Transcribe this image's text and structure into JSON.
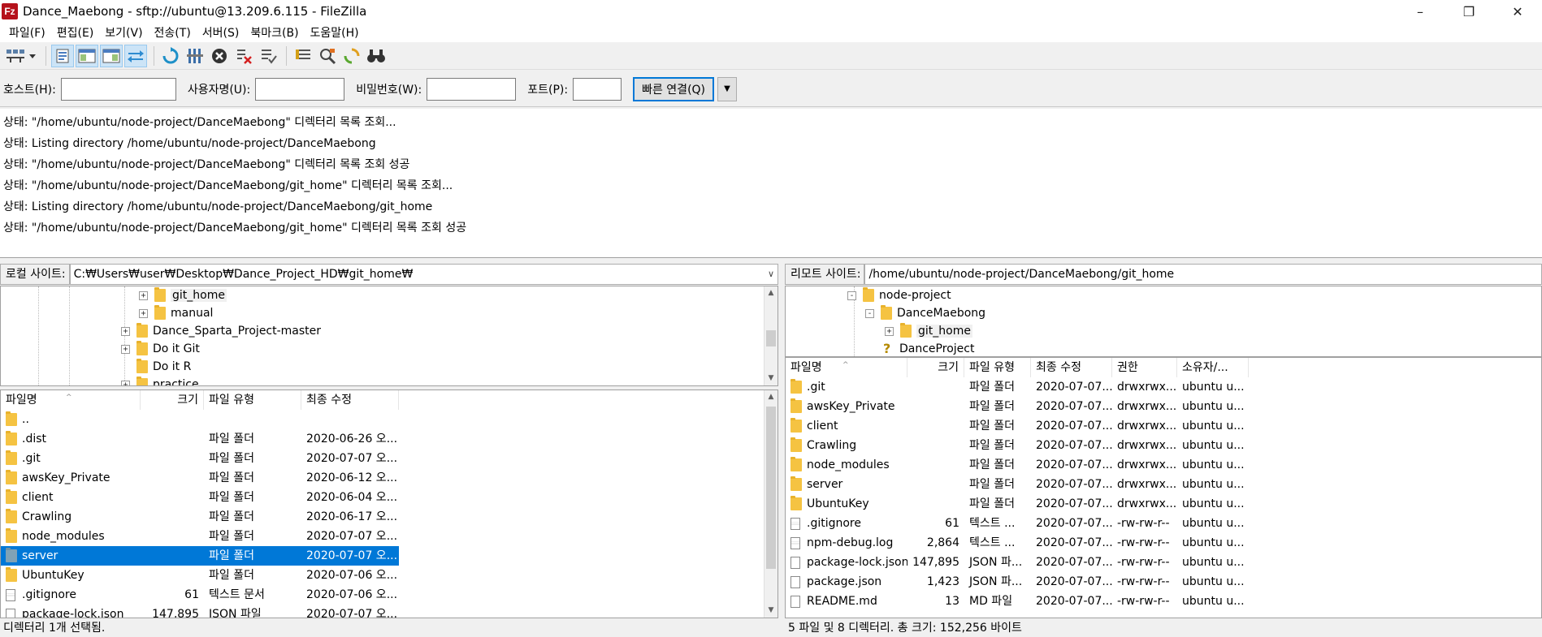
{
  "window": {
    "title": "Dance_Maebong - sftp://ubuntu@13.209.6.115 - FileZilla",
    "app_icon_text": "Fz"
  },
  "menu": [
    "파일(F)",
    "편집(E)",
    "보기(V)",
    "전송(T)",
    "서버(S)",
    "북마크(B)",
    "도움말(H)"
  ],
  "toolbar_icons": [
    "site-manager-icon",
    "toggle-log-icon",
    "toggle-local-tree-icon",
    "toggle-remote-tree-icon",
    "toggle-queue-icon",
    "refresh-icon",
    "process-queue-icon",
    "cancel-icon",
    "disconnect-icon",
    "reconnect-icon",
    "filter-icon",
    "compare-icon",
    "sync-browse-icon",
    "search-icon"
  ],
  "quickconnect": {
    "host_label": "호스트(H):",
    "user_label": "사용자명(U):",
    "pass_label": "비밀번호(W):",
    "port_label": "포트(P):",
    "host_value": "",
    "user_value": "",
    "pass_value": "",
    "port_value": "",
    "button": "빠른 연결(Q)"
  },
  "log": [
    "상태:  \"/home/ubuntu/node-project/DanceMaebong\" 디렉터리 목록 조회...",
    "상태:  Listing directory /home/ubuntu/node-project/DanceMaebong",
    "상태:  \"/home/ubuntu/node-project/DanceMaebong\" 디렉터리 목록 조회 성공",
    "상태:  \"/home/ubuntu/node-project/DanceMaebong/git_home\" 디렉터리 목록 조회...",
    "상태:  Listing directory /home/ubuntu/node-project/DanceMaebong/git_home",
    "상태:  \"/home/ubuntu/node-project/DanceMaebong/git_home\" 디렉터리 목록 조회 성공"
  ],
  "local": {
    "site_label": "로컬 사이트:",
    "path": "C:₩Users₩user₩Desktop₩Dance_Project_HD₩git_home₩",
    "tree": [
      {
        "label": "git_home",
        "expander": "+",
        "highlight": true
      },
      {
        "label": "manual",
        "expander": "+",
        "highlight": false
      },
      {
        "label": "Dance_Sparta_Project-master",
        "expander": "+",
        "highlight": false
      },
      {
        "label": "Do it Git",
        "expander": "+",
        "highlight": false
      },
      {
        "label": "Do it R",
        "expander": "",
        "highlight": false
      },
      {
        "label": "practice",
        "expander": "+",
        "highlight": false
      }
    ],
    "columns": [
      "파일명",
      "크기",
      "파일 유형",
      "최종 수정"
    ],
    "files": [
      {
        "name": "..",
        "size": "",
        "type": "",
        "modified": "",
        "icon": "folder"
      },
      {
        "name": ".dist",
        "size": "",
        "type": "파일 폴더",
        "modified": "2020-06-26 오...",
        "icon": "folder"
      },
      {
        "name": ".git",
        "size": "",
        "type": "파일 폴더",
        "modified": "2020-07-07 오...",
        "icon": "folder"
      },
      {
        "name": "awsKey_Private",
        "size": "",
        "type": "파일 폴더",
        "modified": "2020-06-12 오...",
        "icon": "folder"
      },
      {
        "name": "client",
        "size": "",
        "type": "파일 폴더",
        "modified": "2020-06-04 오...",
        "icon": "folder"
      },
      {
        "name": "Crawling",
        "size": "",
        "type": "파일 폴더",
        "modified": "2020-06-17 오...",
        "icon": "folder"
      },
      {
        "name": "node_modules",
        "size": "",
        "type": "파일 폴더",
        "modified": "2020-07-07 오...",
        "icon": "folder"
      },
      {
        "name": "server",
        "size": "",
        "type": "파일 폴더",
        "modified": "2020-07-07 오...",
        "icon": "folder",
        "selected": true
      },
      {
        "name": "UbuntuKey",
        "size": "",
        "type": "파일 폴더",
        "modified": "2020-07-06 오...",
        "icon": "folder"
      },
      {
        "name": ".gitignore",
        "size": "61",
        "type": "텍스트 문서",
        "modified": "2020-07-06 오...",
        "icon": "txt"
      },
      {
        "name": "package-lock.json",
        "size": "147,895",
        "type": "JSON 파일",
        "modified": "2020-07-07 오...",
        "icon": "file"
      }
    ],
    "status": "디렉터리 1개 선택됨."
  },
  "remote": {
    "site_label": "리모트 사이트:",
    "path": "/home/ubuntu/node-project/DanceMaebong/git_home",
    "tree": [
      {
        "label": "node-project",
        "expander": "-",
        "indent": 0
      },
      {
        "label": "DanceMaebong",
        "expander": "-",
        "indent": 1
      },
      {
        "label": "git_home",
        "expander": "+",
        "indent": 2
      },
      {
        "label": "DanceProject",
        "expander": "?",
        "indent": 1
      }
    ],
    "columns": [
      "파일명",
      "크기",
      "파일 유형",
      "최종 수정",
      "권한",
      "소유자/..."
    ],
    "files": [
      {
        "name": ".git",
        "size": "",
        "type": "파일 폴더",
        "modified": "2020-07-07...",
        "perm": "drwxrwx...",
        "owner": "ubuntu u...",
        "icon": "folder"
      },
      {
        "name": "awsKey_Private",
        "size": "",
        "type": "파일 폴더",
        "modified": "2020-07-07...",
        "perm": "drwxrwx...",
        "owner": "ubuntu u...",
        "icon": "folder"
      },
      {
        "name": "client",
        "size": "",
        "type": "파일 폴더",
        "modified": "2020-07-07...",
        "perm": "drwxrwx...",
        "owner": "ubuntu u...",
        "icon": "folder"
      },
      {
        "name": "Crawling",
        "size": "",
        "type": "파일 폴더",
        "modified": "2020-07-07...",
        "perm": "drwxrwx...",
        "owner": "ubuntu u...",
        "icon": "folder"
      },
      {
        "name": "node_modules",
        "size": "",
        "type": "파일 폴더",
        "modified": "2020-07-07...",
        "perm": "drwxrwx...",
        "owner": "ubuntu u...",
        "icon": "folder"
      },
      {
        "name": "server",
        "size": "",
        "type": "파일 폴더",
        "modified": "2020-07-07...",
        "perm": "drwxrwx...",
        "owner": "ubuntu u...",
        "icon": "folder"
      },
      {
        "name": "UbuntuKey",
        "size": "",
        "type": "파일 폴더",
        "modified": "2020-07-07...",
        "perm": "drwxrwx...",
        "owner": "ubuntu u...",
        "icon": "folder"
      },
      {
        "name": ".gitignore",
        "size": "61",
        "type": "텍스트 ...",
        "modified": "2020-07-07...",
        "perm": "-rw-rw-r--",
        "owner": "ubuntu u...",
        "icon": "txt"
      },
      {
        "name": "npm-debug.log",
        "size": "2,864",
        "type": "텍스트 ...",
        "modified": "2020-07-07...",
        "perm": "-rw-rw-r--",
        "owner": "ubuntu u...",
        "icon": "txt"
      },
      {
        "name": "package-lock.json",
        "size": "147,895",
        "type": "JSON 파...",
        "modified": "2020-07-07...",
        "perm": "-rw-rw-r--",
        "owner": "ubuntu u...",
        "icon": "file"
      },
      {
        "name": "package.json",
        "size": "1,423",
        "type": "JSON 파...",
        "modified": "2020-07-07...",
        "perm": "-rw-rw-r--",
        "owner": "ubuntu u...",
        "icon": "file"
      },
      {
        "name": "README.md",
        "size": "13",
        "type": "MD 파일",
        "modified": "2020-07-07...",
        "perm": "-rw-rw-r--",
        "owner": "ubuntu u...",
        "icon": "file"
      }
    ],
    "status": "5 파일 및 8 디렉터리. 총 크기: 152,256 바이트"
  },
  "colors": {
    "selection": "#0078d7",
    "folder": "#f5c342"
  }
}
